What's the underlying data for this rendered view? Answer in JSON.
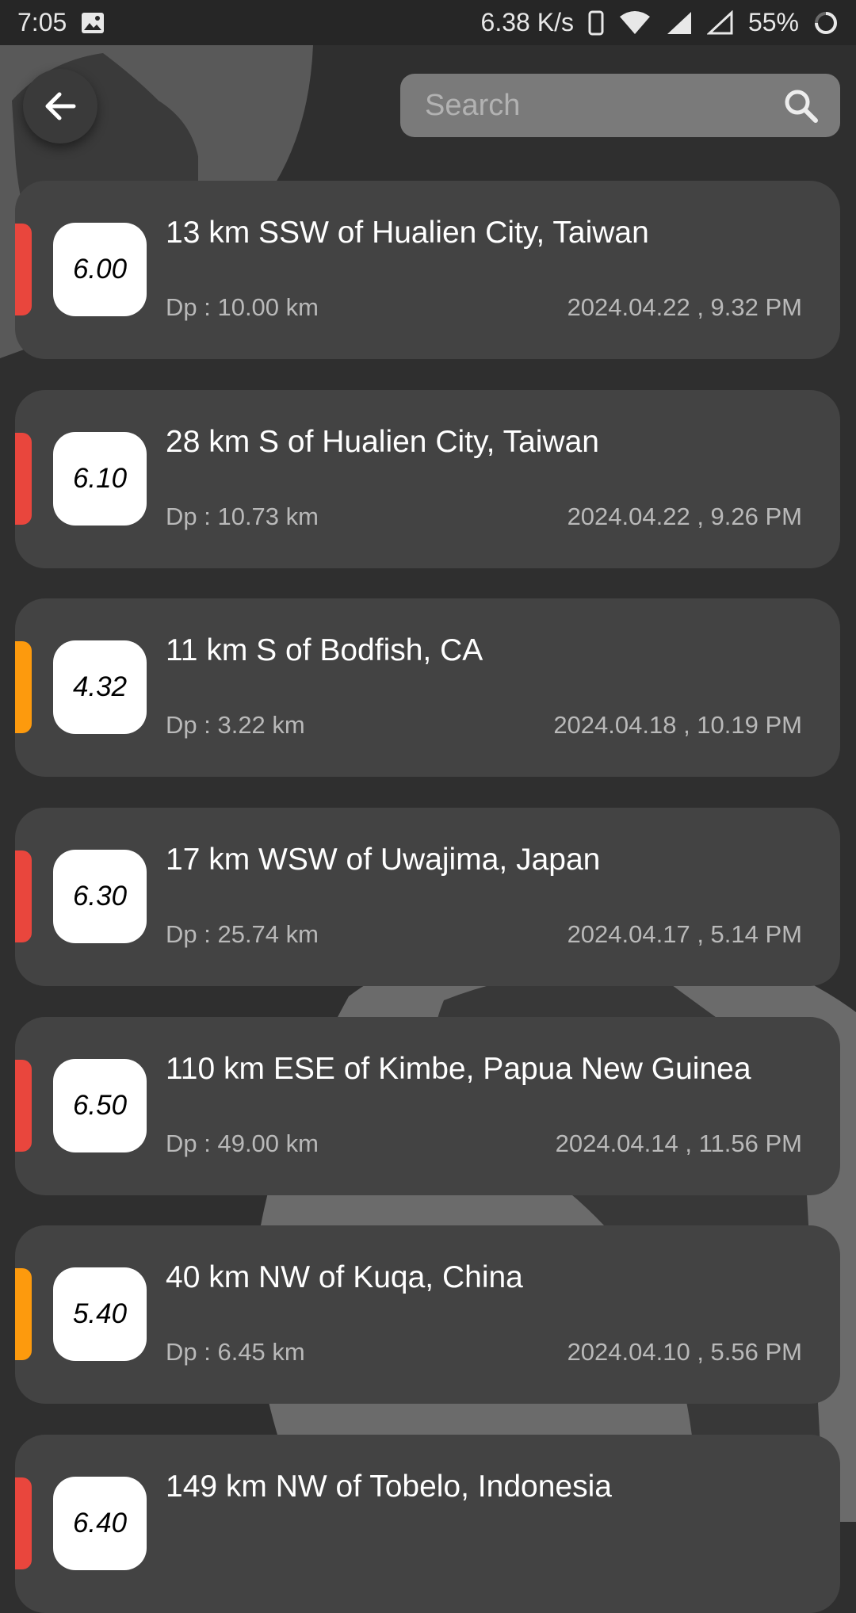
{
  "status_bar": {
    "time": "7:05",
    "network_speed": "6.38 K/s",
    "battery": "55%",
    "icons": [
      "image-icon",
      "phone-icon",
      "wifi-icon",
      "signal-icon",
      "signal-empty-icon",
      "loading-icon"
    ]
  },
  "header": {
    "back_icon": "arrow-left-icon",
    "search_placeholder": "Search",
    "search_value": "",
    "search_icon": "search-icon"
  },
  "colors": {
    "background": "#2f2f2f",
    "card": "#434343",
    "strip_red": "#e9463d",
    "strip_orange": "#fd9a0d",
    "search_bg": "#7a7a7a"
  },
  "earthquakes": [
    {
      "magnitude": "6.00",
      "place": "13 km SSW of Hualien City, Taiwan",
      "depth": "Dp : 10.00 km",
      "datetime": "2024.04.22 , 9.32 PM",
      "severity": "red"
    },
    {
      "magnitude": "6.10",
      "place": "28 km S of Hualien City, Taiwan",
      "depth": "Dp : 10.73 km",
      "datetime": "2024.04.22 , 9.26 PM",
      "severity": "red"
    },
    {
      "magnitude": "4.32",
      "place": "11 km S of Bodfish, CA",
      "depth": "Dp : 3.22 km",
      "datetime": "2024.04.18 , 10.19 PM",
      "severity": "orange"
    },
    {
      "magnitude": "6.30",
      "place": "17 km WSW of Uwajima, Japan",
      "depth": "Dp : 25.74 km",
      "datetime": "2024.04.17 , 5.14 PM",
      "severity": "red"
    },
    {
      "magnitude": "6.50",
      "place": "110 km ESE of Kimbe, Papua New Guinea",
      "depth": "Dp : 49.00 km",
      "datetime": "2024.04.14 , 11.56 PM",
      "severity": "red"
    },
    {
      "magnitude": "5.40",
      "place": "40 km NW of Kuqa, China",
      "depth": "Dp : 6.45 km",
      "datetime": "2024.04.10 , 5.56 PM",
      "severity": "orange"
    },
    {
      "magnitude": "6.40",
      "place": "149 km NW of Tobelo, Indonesia",
      "depth": "",
      "datetime": "",
      "severity": "red"
    }
  ]
}
